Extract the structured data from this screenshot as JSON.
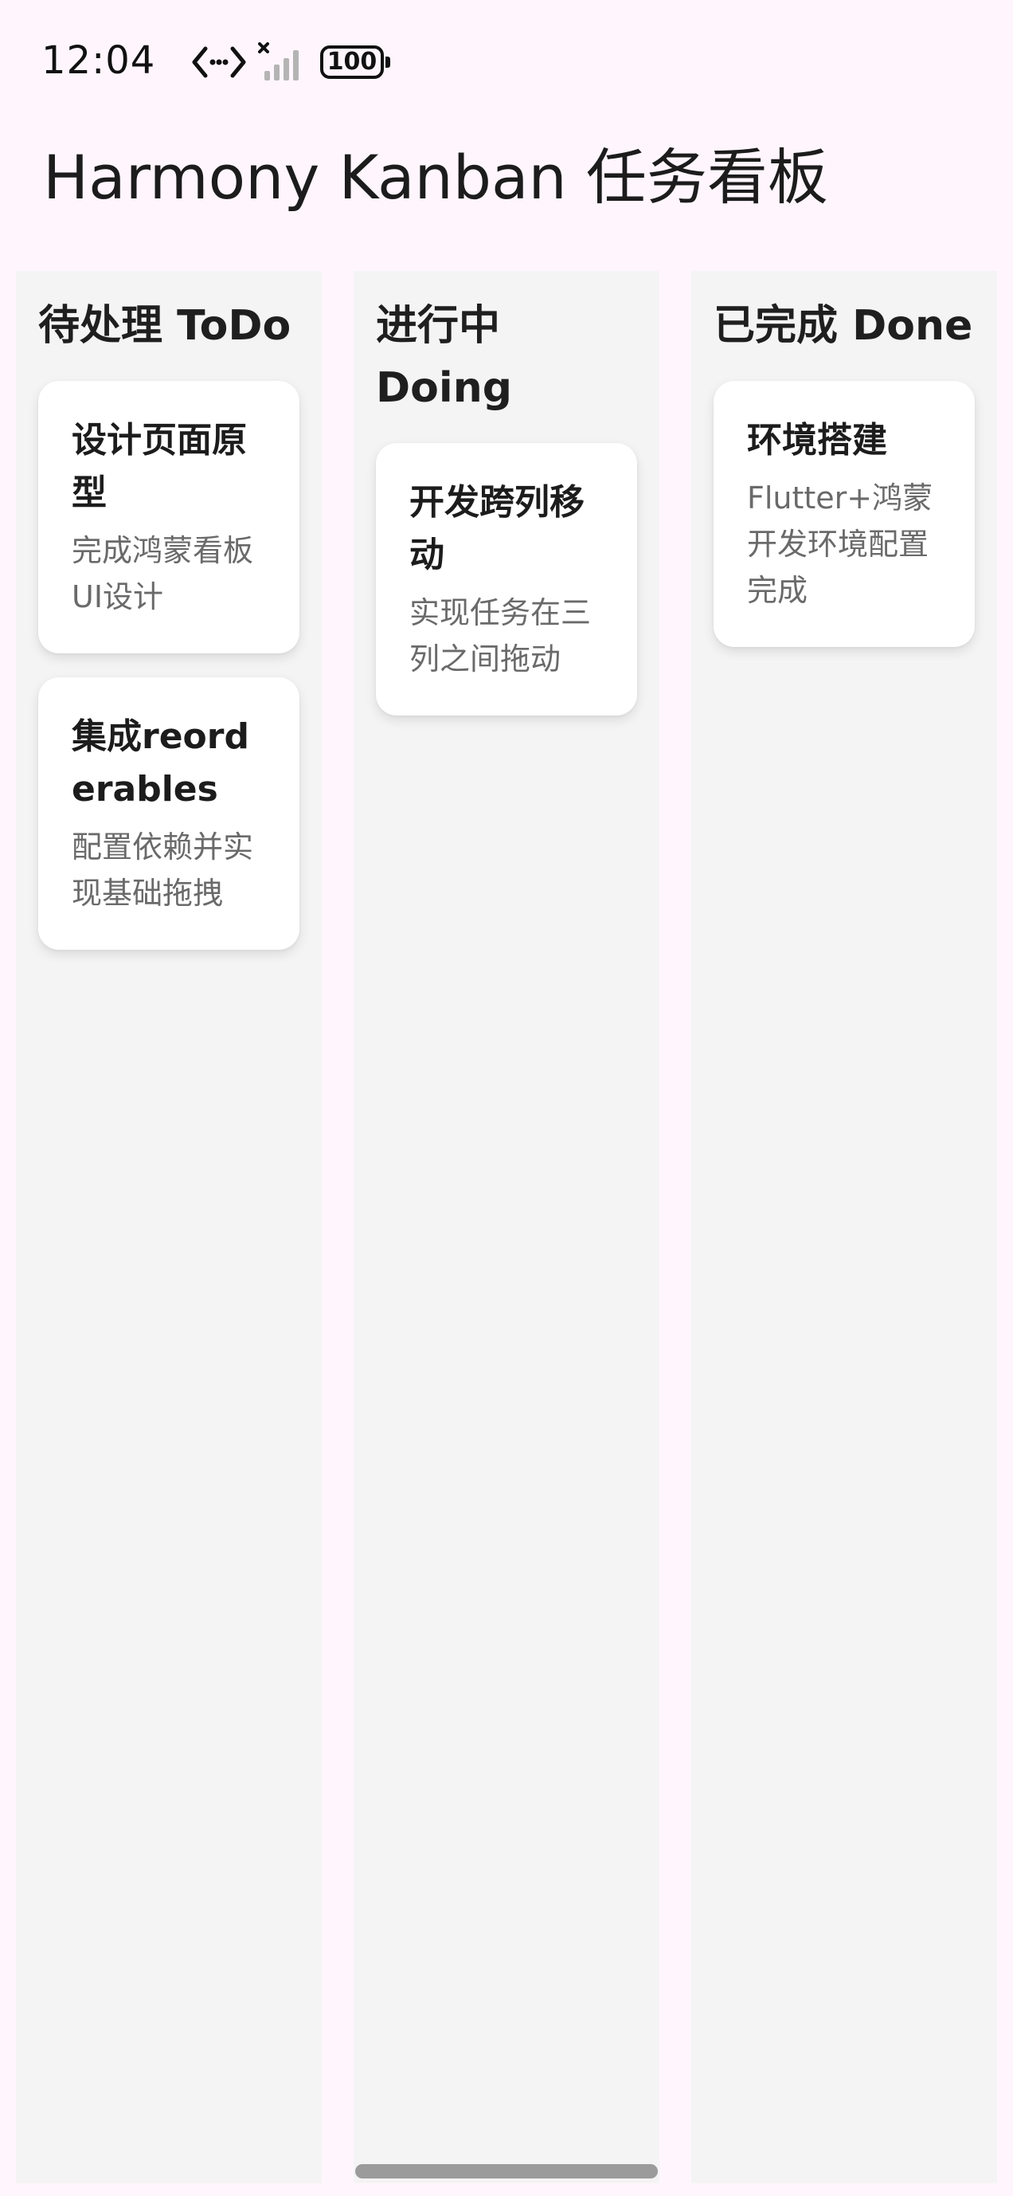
{
  "status_bar": {
    "time": "12:04",
    "battery_level": "100",
    "icons": [
      "data-transfer-icon",
      "signal-no-service-icon",
      "battery-icon"
    ]
  },
  "app": {
    "title": "Harmony Kanban 任务看板"
  },
  "columns": [
    {
      "title": "待处理 ToDo",
      "cards": [
        {
          "title": "设计页面原型",
          "desc": "完成鸿蒙看板UI设计"
        },
        {
          "title": "集成reorderables",
          "desc": "配置依赖并实现基础拖拽"
        }
      ]
    },
    {
      "title": "进行中 Doing",
      "cards": [
        {
          "title": "开发跨列移动",
          "desc": "实现任务在三列之间拖动"
        }
      ]
    },
    {
      "title": "已完成 Done",
      "cards": [
        {
          "title": "环境搭建",
          "desc": "Flutter+鸿蒙开发环境配置完成"
        }
      ]
    }
  ],
  "colors": {
    "background": "#fff6fd",
    "column": "#f4f4f4",
    "card": "#ffffff",
    "description_text": "#6a6a6a"
  }
}
